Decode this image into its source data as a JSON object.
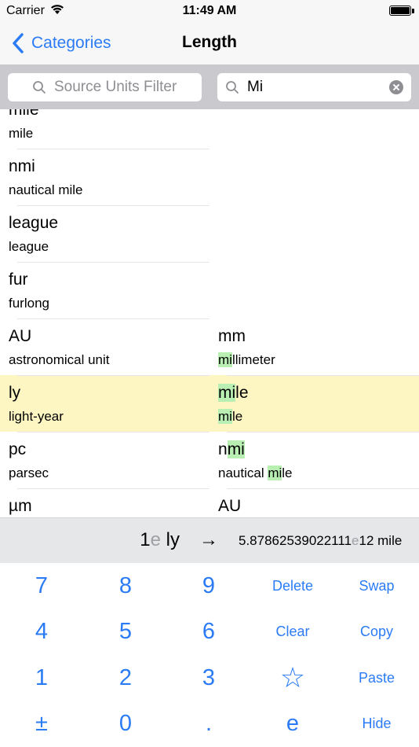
{
  "status_bar": {
    "carrier": "Carrier",
    "time": "11:49 AM"
  },
  "nav": {
    "back_label": "Categories",
    "title": "Length"
  },
  "search": {
    "source_placeholder": "Source Units Filter",
    "target_value": "Mi"
  },
  "source_units": [
    {
      "symbol": "mile",
      "name": "mile"
    },
    {
      "symbol": "nmi",
      "name": "nautical mile"
    },
    {
      "symbol": "league",
      "name": "league"
    },
    {
      "symbol": "fur",
      "name": "furlong"
    },
    {
      "symbol": "AU",
      "name": "astronomical unit"
    },
    {
      "symbol": "ly",
      "name": "light-year"
    },
    {
      "symbol": "pc",
      "name": "parsec"
    },
    {
      "symbol": "µm",
      "name": ""
    }
  ],
  "target_units": [
    {
      "symbol_pre": "",
      "symbol_hl": "",
      "symbol_post": "",
      "name_pre": "",
      "name_hl": "",
      "name_post": ""
    },
    {
      "symbol_pre": "",
      "symbol_hl": "",
      "symbol_post": "",
      "name_pre": "",
      "name_hl": "",
      "name_post": ""
    },
    {
      "symbol_pre": "",
      "symbol_hl": "",
      "symbol_post": "",
      "name_pre": "",
      "name_hl": "",
      "name_post": ""
    },
    {
      "symbol_pre": "",
      "symbol_hl": "",
      "symbol_post": "",
      "name_pre": "",
      "name_hl": "",
      "name_post": ""
    },
    {
      "symbol_pre": "mm",
      "symbol_hl": "",
      "symbol_post": "",
      "name_pre": "",
      "name_hl": "mi",
      "name_post": "llimeter"
    },
    {
      "symbol_pre": "",
      "symbol_hl": "mi",
      "symbol_post": "le",
      "name_pre": "",
      "name_hl": "mi",
      "name_post": "le"
    },
    {
      "symbol_pre": "n",
      "symbol_hl": "mi",
      "symbol_post": "",
      "name_pre": "nautical ",
      "name_hl": "mi",
      "name_post": "le"
    },
    {
      "symbol_pre": "AU",
      "symbol_hl": "",
      "symbol_post": "",
      "name_pre": "",
      "name_hl": "",
      "name_post": ""
    }
  ],
  "conversion": {
    "input_mantissa": "1",
    "input_exp": "e",
    "input_unit": " ly",
    "arrow": "→",
    "result_mantissa": "5.87862539022111",
    "result_exp": "e",
    "result_tail": "12 mile"
  },
  "keypad": {
    "k7": "7",
    "k8": "8",
    "k9": "9",
    "delete": "Delete",
    "swap": "Swap",
    "k4": "4",
    "k5": "5",
    "k6": "6",
    "clear": "Clear",
    "copy": "Copy",
    "k1": "1",
    "k2": "2",
    "k3": "3",
    "favorite": "☆",
    "paste": "Paste",
    "plusminus": "±",
    "k0": "0",
    "dot": ".",
    "exp": "e",
    "hide": "Hide"
  },
  "colors": {
    "accent": "#2b7bf5",
    "selection": "#fdf6c3",
    "match_highlight": "#b9efb3"
  }
}
